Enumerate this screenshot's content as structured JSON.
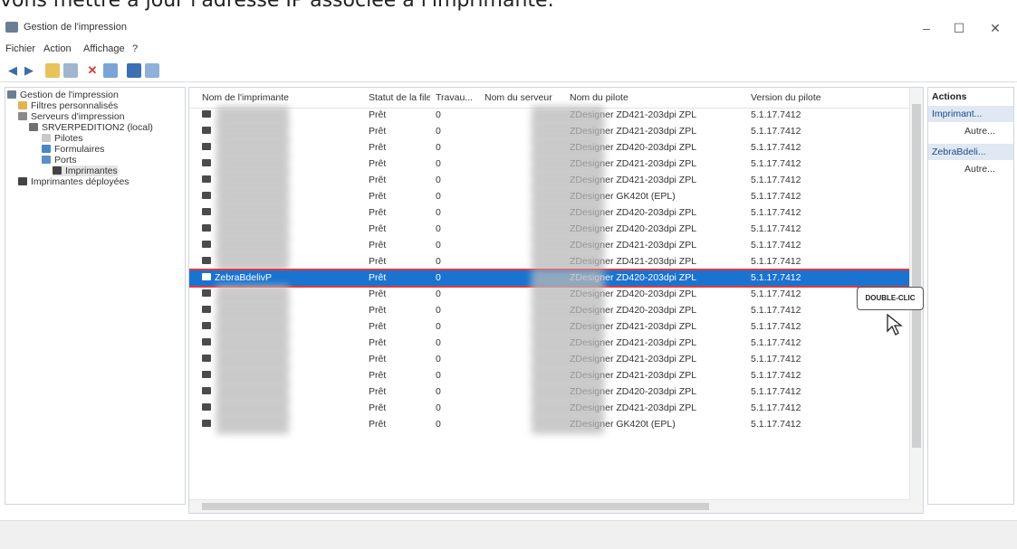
{
  "caption": "vons mettre à jour l'adresse IP associée à l'imprimante.",
  "window": {
    "title": "Gestion de l'impression",
    "controls": [
      "–",
      "☐",
      "✕"
    ]
  },
  "menu": [
    "Fichier",
    "Action",
    "Affichage",
    "?"
  ],
  "tree": [
    {
      "label": "Gestion de l'impression",
      "indent": 0
    },
    {
      "label": "Filtres personnalisés",
      "indent": 1
    },
    {
      "label": "Serveurs d'impression",
      "indent": 1
    },
    {
      "label": "SRVERPEDITION2 (local)",
      "indent": 2
    },
    {
      "label": "Pilotes",
      "indent": 3
    },
    {
      "label": "Formulaires",
      "indent": 3
    },
    {
      "label": "Ports",
      "indent": 3
    },
    {
      "label": "Imprimantes",
      "indent": 4
    },
    {
      "label": "Imprimantes déployées",
      "indent": 1
    }
  ],
  "columns": [
    "Nom de l'imprimante",
    "Statut de la file...",
    "Travau...",
    "Nom du serveur",
    "Nom du pilote",
    "Version du pilote"
  ],
  "rows": [
    {
      "name": "",
      "status": "Prêt",
      "jobs": "0",
      "server": "",
      "driver": "ZDesigner ZD421-203dpi ZPL",
      "version": "5.1.17.7412"
    },
    {
      "name": "",
      "status": "Prêt",
      "jobs": "0",
      "server": "",
      "driver": "ZDesigner ZD421-203dpi ZPL",
      "version": "5.1.17.7412"
    },
    {
      "name": "",
      "status": "Prêt",
      "jobs": "0",
      "server": "",
      "driver": "ZDesigner ZD420-203dpi ZPL",
      "version": "5.1.17.7412"
    },
    {
      "name": "",
      "status": "Prêt",
      "jobs": "0",
      "server": "",
      "driver": "ZDesigner ZD421-203dpi ZPL",
      "version": "5.1.17.7412"
    },
    {
      "name": "",
      "status": "Prêt",
      "jobs": "0",
      "server": "",
      "driver": "ZDesigner ZD421-203dpi ZPL",
      "version": "5.1.17.7412"
    },
    {
      "name": "",
      "status": "Prêt",
      "jobs": "0",
      "server": "",
      "driver": "ZDesigner GK420t (EPL)",
      "version": "5.1.17.7412"
    },
    {
      "name": "",
      "status": "Prêt",
      "jobs": "0",
      "server": "",
      "driver": "ZDesigner ZD420-203dpi ZPL",
      "version": "5.1.17.7412"
    },
    {
      "name": "",
      "status": "Prêt",
      "jobs": "0",
      "server": "",
      "driver": "ZDesigner ZD420-203dpi ZPL",
      "version": "5.1.17.7412"
    },
    {
      "name": "",
      "status": "Prêt",
      "jobs": "0",
      "server": "",
      "driver": "ZDesigner ZD421-203dpi ZPL",
      "version": "5.1.17.7412"
    },
    {
      "name": "",
      "status": "Prêt",
      "jobs": "0",
      "server": "",
      "driver": "ZDesigner ZD421-203dpi ZPL",
      "version": "5.1.17.7412"
    },
    {
      "name": "ZebraBdelivP",
      "status": "Prêt",
      "jobs": "0",
      "server": "",
      "driver": "ZDesigner ZD420-203dpi ZPL",
      "version": "5.1.17.7412"
    },
    {
      "name": "",
      "status": "Prêt",
      "jobs": "0",
      "server": "",
      "driver": "ZDesigner ZD420-203dpi ZPL",
      "version": "5.1.17.7412"
    },
    {
      "name": "",
      "status": "Prêt",
      "jobs": "0",
      "server": "",
      "driver": "ZDesigner ZD420-203dpi ZPL",
      "version": "5.1.17.7412"
    },
    {
      "name": "",
      "status": "Prêt",
      "jobs": "0",
      "server": "",
      "driver": "ZDesigner ZD421-203dpi ZPL",
      "version": "5.1.17.7412"
    },
    {
      "name": "",
      "status": "Prêt",
      "jobs": "0",
      "server": "",
      "driver": "ZDesigner ZD421-203dpi ZPL",
      "version": "5.1.17.7412"
    },
    {
      "name": "",
      "status": "Prêt",
      "jobs": "0",
      "server": "",
      "driver": "ZDesigner ZD421-203dpi ZPL",
      "version": "5.1.17.7412"
    },
    {
      "name": "",
      "status": "Prêt",
      "jobs": "0",
      "server": "",
      "driver": "ZDesigner ZD421-203dpi ZPL",
      "version": "5.1.17.7412"
    },
    {
      "name": "",
      "status": "Prêt",
      "jobs": "0",
      "server": "",
      "driver": "ZDesigner ZD420-203dpi ZPL",
      "version": "5.1.17.7412"
    },
    {
      "name": "",
      "status": "Prêt",
      "jobs": "0",
      "server": "",
      "driver": "ZDesigner ZD421-203dpi ZPL",
      "version": "5.1.17.7412"
    },
    {
      "name": "",
      "status": "Prêt",
      "jobs": "0",
      "server": "",
      "driver": "ZDesigner GK420t (EPL)",
      "version": "5.1.17.7412"
    }
  ],
  "selected_row": 10,
  "actions": {
    "header": "Actions",
    "sections": [
      {
        "title": "Imprimant...",
        "more": "Autre..."
      },
      {
        "title": "ZebraBdeli...",
        "more": "Autre..."
      }
    ]
  },
  "callout": "DOUBLE-CLIC",
  "colors": {
    "selection": "#1a73d1",
    "highlight_border": "#e03b3b",
    "pane_border": "#cfd6de"
  },
  "icons": [
    "printer-icon",
    "folder-icon",
    "server-icon",
    "driver-icon",
    "form-icon",
    "port-icon",
    "back-arrow-icon",
    "forward-arrow-icon",
    "delete-icon",
    "help-icon"
  ]
}
